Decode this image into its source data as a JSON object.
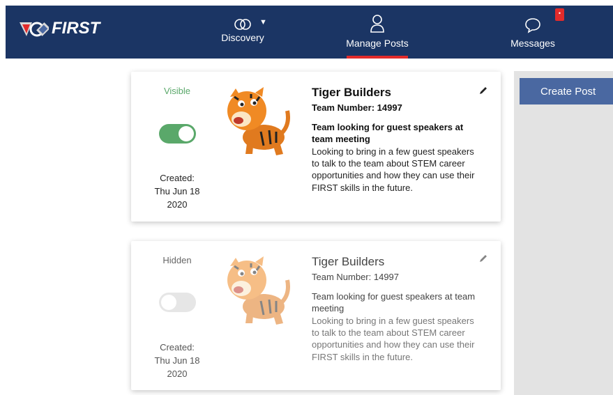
{
  "app": {
    "logo_text": "FIRST"
  },
  "nav": {
    "discovery_label": "Discovery",
    "manage_posts_label": "Manage Posts",
    "messages_label": "Messages",
    "messages_badge": "•"
  },
  "sidebar": {
    "create_post_label": "Create Post"
  },
  "posts": [
    {
      "status": "Visible",
      "enabled": true,
      "created_label": "Created:",
      "created_date": "Thu Jun 18",
      "created_year": "2020",
      "team_name": "Tiger Builders",
      "team_number": "Team Number: 14997",
      "headline": "Team looking for guest speakers at team meeting",
      "description": "Looking to bring in a few guest speakers to talk to the team about STEM career opportunities and how they can use their FIRST skills in the future."
    },
    {
      "status": "Hidden",
      "enabled": false,
      "created_label": "Created:",
      "created_date": "Thu Jun 18",
      "created_year": "2020",
      "team_name": "Tiger Builders",
      "team_number": "Team Number: 14997",
      "headline": "Team looking for guest speakers at team meeting",
      "description": "Looking to bring in a few guest speakers to talk to the team about STEM career opportunities and how they can use their FIRST skills in the future."
    }
  ],
  "colors": {
    "nav_bg": "#1b3564",
    "accent_red": "#e22b2b",
    "toggle_on": "#5aa86a",
    "create_btn": "#4a68a1"
  }
}
